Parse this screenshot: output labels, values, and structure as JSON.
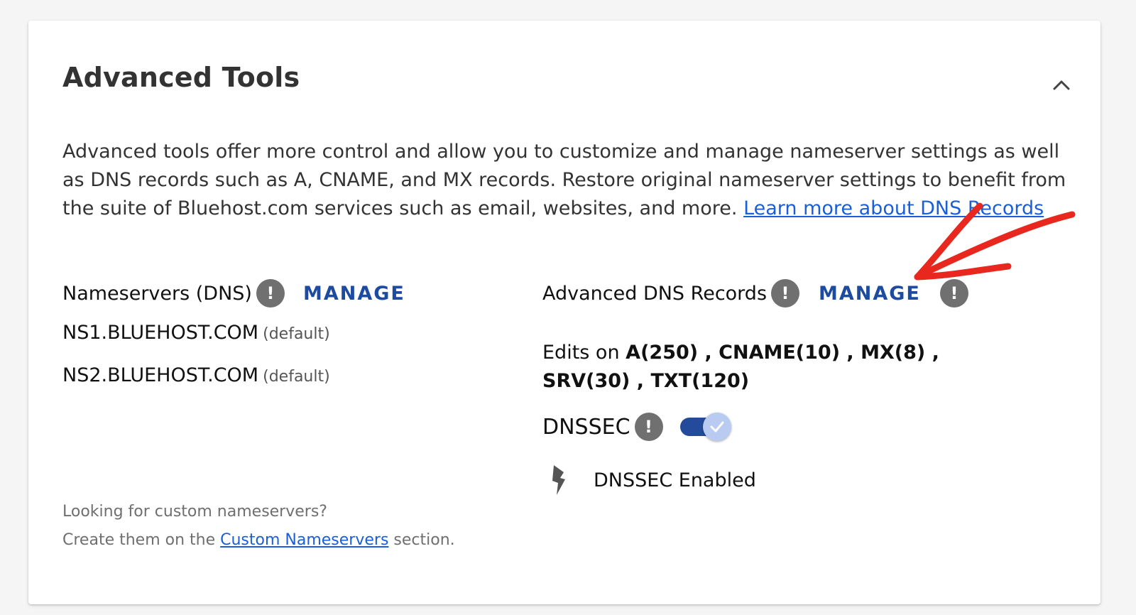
{
  "panel": {
    "title": "Advanced Tools",
    "description": "Advanced tools offer more control and allow you to customize and manage nameserver settings as well as DNS records such as A, CNAME, and MX records. Restore original nameserver settings to benefit from the suite of Bluehost.com services such as email, websites, and more.",
    "learn_more_link": "Learn more about DNS Records",
    "collapse_icon": "chevron-up-icon"
  },
  "nameservers": {
    "label": "Nameservers (DNS)",
    "info_glyph": "!",
    "manage_label": "MANAGE",
    "servers": [
      {
        "host": "NS1.BLUEHOST.COM",
        "tag": "(default)"
      },
      {
        "host": "NS2.BLUEHOST.COM",
        "tag": "(default)"
      }
    ]
  },
  "dns_records": {
    "label": "Advanced DNS Records",
    "info_glyph": "!",
    "manage_label": "MANAGE",
    "edits_prefix": "Edits on",
    "records": "A(250) , CNAME(10) , MX(8) , SRV(30) , TXT(120)"
  },
  "dnssec": {
    "label": "DNSSEC",
    "info_glyph": "!",
    "enabled": true,
    "status_text": "DNSSEC Enabled",
    "status_icon": "bolt-icon"
  },
  "footer": {
    "line1": "Looking for custom nameservers?",
    "line2_prefix": "Create them on the",
    "link": "Custom Nameservers",
    "line2_suffix": "section."
  },
  "colors": {
    "manage": "#1d4ba0",
    "link": "#1a5fd8",
    "toggle_track": "#244b9b",
    "annotation_arrow": "#e8281e"
  }
}
